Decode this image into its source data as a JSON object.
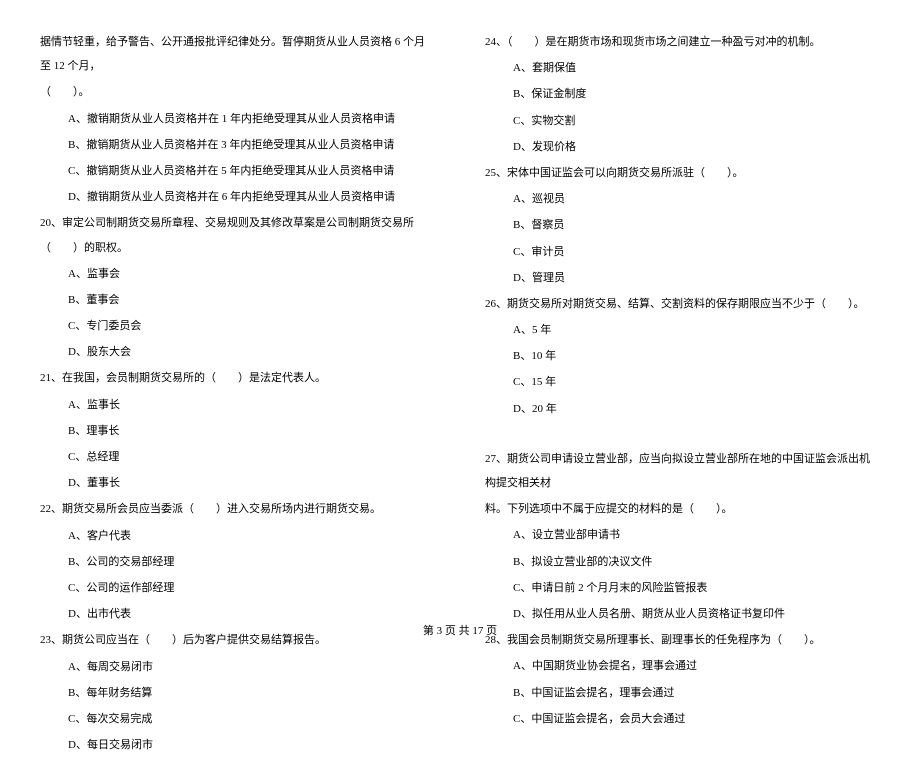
{
  "left_intro_line1": "据情节轻重，给予警告、公开通报批评纪律处分。暂停期货从业人员资格 6 个月至 12 个月，",
  "left_intro_line2": "（　　）。",
  "q19": {
    "a": "A、撤销期货从业人员资格并在 1 年内拒绝受理其从业人员资格申请",
    "b": "B、撤销期货从业人员资格并在 3 年内拒绝受理其从业人员资格申请",
    "c": "C、撤销期货从业人员资格并在 5 年内拒绝受理其从业人员资格申请",
    "d": "D、撤销期货从业人员资格并在 6 年内拒绝受理其从业人员资格申请"
  },
  "q20": {
    "text": "20、审定公司制期货交易所章程、交易规则及其修改草案是公司制期货交易所（　　）的职权。",
    "a": "A、监事会",
    "b": "B、董事会",
    "c": "C、专门委员会",
    "d": "D、股东大会"
  },
  "q21": {
    "text": "21、在我国，会员制期货交易所的（　　）是法定代表人。",
    "a": "A、监事长",
    "b": "B、理事长",
    "c": "C、总经理",
    "d": "D、董事长"
  },
  "q22": {
    "text": "22、期货交易所会员应当委派（　　）进入交易所场内进行期货交易。",
    "a": "A、客户代表",
    "b": "B、公司的交易部经理",
    "c": "C、公司的运作部经理",
    "d": "D、出市代表"
  },
  "q23": {
    "text": "23、期货公司应当在（　　）后为客户提供交易结算报告。",
    "a": "A、每周交易闭市",
    "b": "B、每年财务结算",
    "c": "C、每次交易完成",
    "d": "D、每日交易闭市"
  },
  "q24": {
    "text": "24、（　　）是在期货市场和现货市场之间建立一种盈亏对冲的机制。",
    "a": "A、套期保值",
    "b": "B、保证金制度",
    "c": "C、实物交割",
    "d": "D、发现价格"
  },
  "q25": {
    "text": "25、宋体中国证监会可以向期货交易所派驻（　　）。",
    "a": "A、巡视员",
    "b": "B、督察员",
    "c": "C、审计员",
    "d": "D、管理员"
  },
  "q26": {
    "text": "26、期货交易所对期货交易、结算、交割资料的保存期限应当不少于（　　）。",
    "a": "A、5 年",
    "b": "B、10 年",
    "c": "C、15 年",
    "d": "D、20 年"
  },
  "q27": {
    "text_line1": "27、期货公司申请设立营业部，应当向拟设立营业部所在地的中国证监会派出机构提交相关材",
    "text_line2": "料。下列选项中不属于应提交的材料的是（　　）。",
    "a": "A、设立营业部申请书",
    "b": "B、拟设立营业部的决议文件",
    "c": "C、申请日前 2 个月月末的风险监管报表",
    "d": "D、拟任用从业人员名册、期货从业人员资格证书复印件"
  },
  "q28": {
    "text": "28、我国会员制期货交易所理事长、副理事长的任免程序为（　　）。",
    "a": "A、中国期货业协会提名，理事会通过",
    "b": "B、中国证监会提名，理事会通过",
    "c": "C、中国证监会提名，会员大会通过"
  },
  "footer": "第 3 页 共 17 页"
}
